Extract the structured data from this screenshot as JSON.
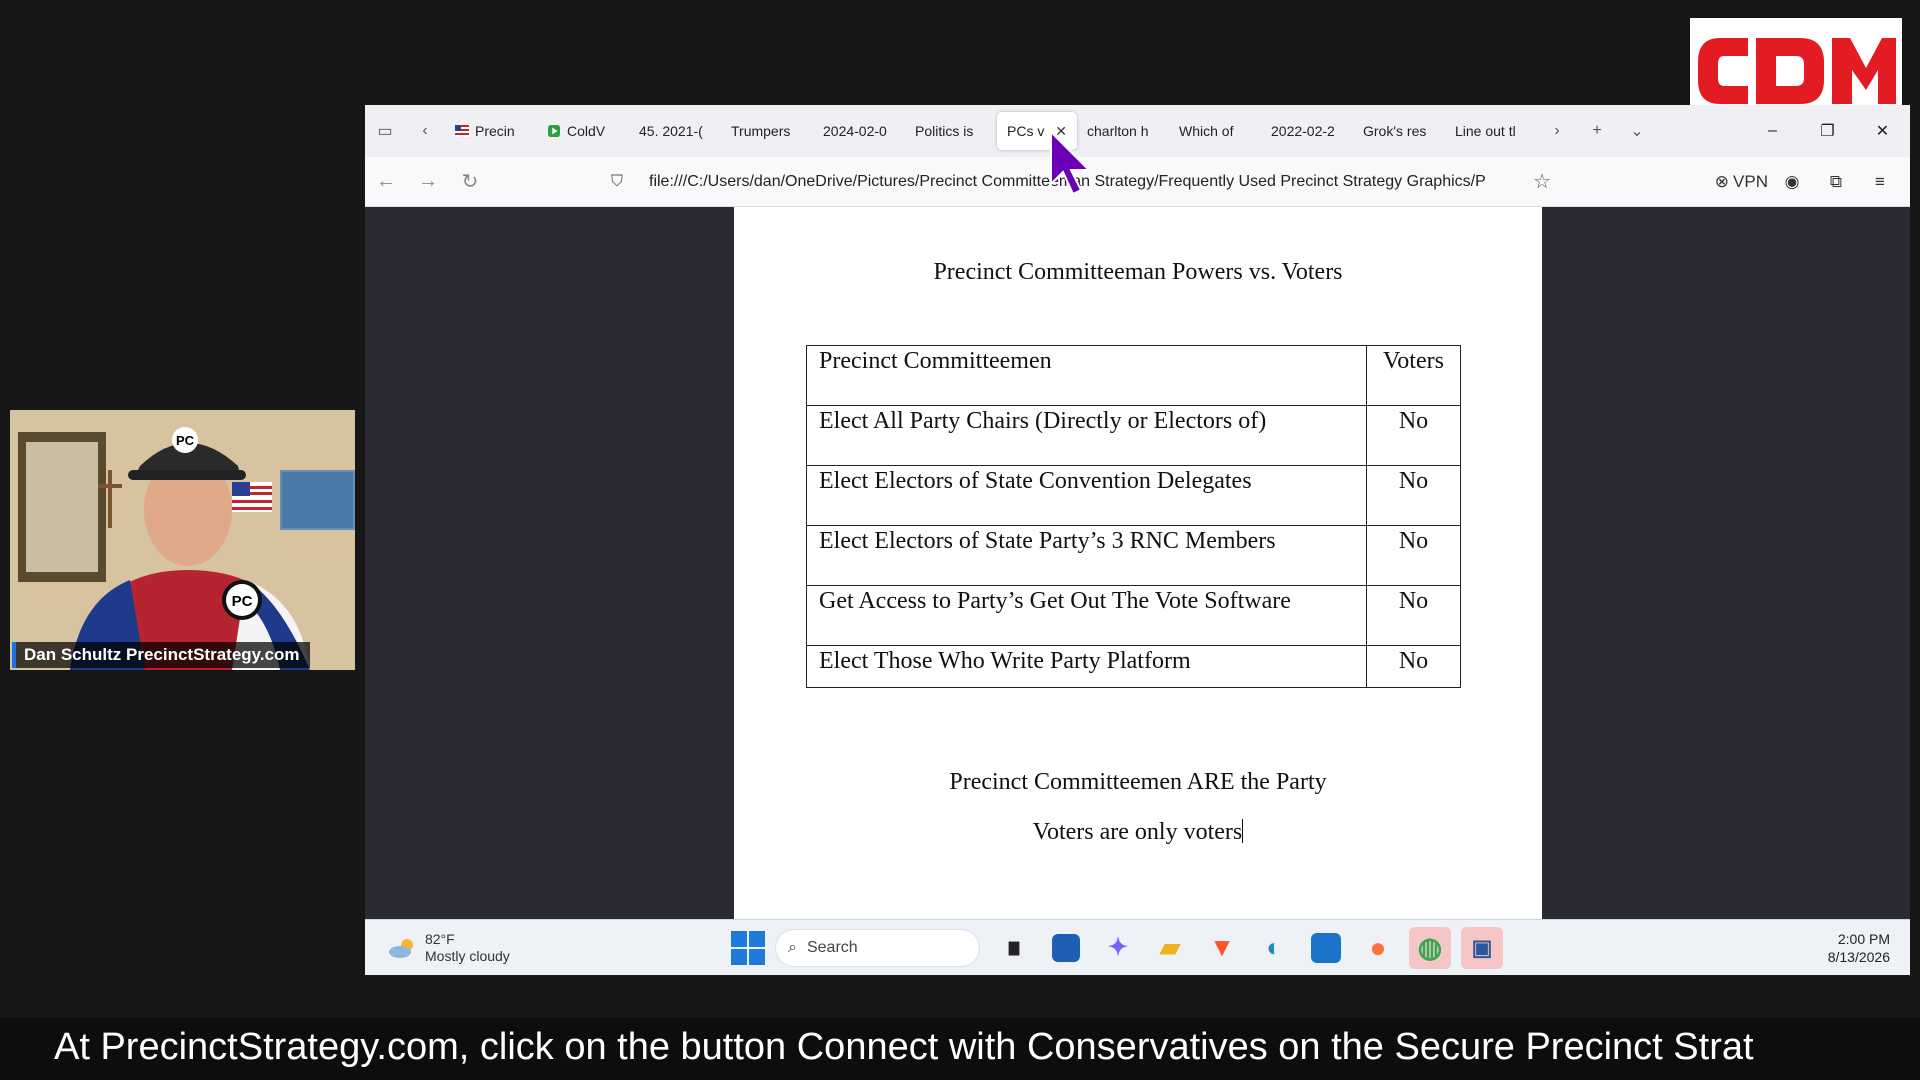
{
  "logo": {
    "text": "CDM",
    "color": "#e31b23"
  },
  "webcam": {
    "label": "Dan Schultz PrecinctStrategy.com",
    "hat_text": "PC",
    "shirt_text": "PC"
  },
  "browser": {
    "tabs": [
      {
        "label": "Precin",
        "icon": "flag-icon"
      },
      {
        "label": "ColdV",
        "icon": "play-icon"
      },
      {
        "label": "45. 2021-(",
        "icon": ""
      },
      {
        "label": "Trumpers",
        "icon": ""
      },
      {
        "label": "2024-02-0",
        "icon": ""
      },
      {
        "label": "Politics is",
        "icon": ""
      },
      {
        "label": "PCs v",
        "icon": "",
        "active": true,
        "close": "✕"
      },
      {
        "label": "charlton h",
        "icon": ""
      },
      {
        "label": "Which of",
        "icon": ""
      },
      {
        "label": "2022-02-2",
        "icon": ""
      },
      {
        "label": "Grok's res",
        "icon": ""
      },
      {
        "label": "Line out tl",
        "icon": ""
      }
    ],
    "url": "file:///C:/Users/dan/OneDrive/Pictures/Precinct Committeeman Strategy/Frequently Used Precinct Strategy Graphics/P",
    "vpn_label": "VPN"
  },
  "document": {
    "title": "Precinct Committeeman Powers vs. Voters",
    "table": {
      "headers": [
        "Precinct Committeemen",
        "Voters"
      ],
      "rows": [
        [
          "Elect All Party Chairs (Directly or Electors of)",
          "No"
        ],
        [
          "Elect Electors of State Convention Delegates",
          "No"
        ],
        [
          "Elect Electors of State Party’s 3 RNC Members",
          "No"
        ],
        [
          "Get Access to Party’s Get Out The Vote Software",
          "No"
        ],
        [
          "Elect Those Who Write Party Platform",
          "No"
        ]
      ]
    },
    "footer_line1": "Precinct Committeemen ARE the Party",
    "footer_line2": "Voters are only voters"
  },
  "taskbar": {
    "weather_temp": "82°F",
    "weather_desc": "Mostly cloudy",
    "search_placeholder": "Search",
    "time": "2:00 PM",
    "date": "8/13/2026"
  },
  "ticker": {
    "text": "At PrecinctStrategy.com, click on the button Connect with Conservatives on the Secure Precinct Strat"
  }
}
